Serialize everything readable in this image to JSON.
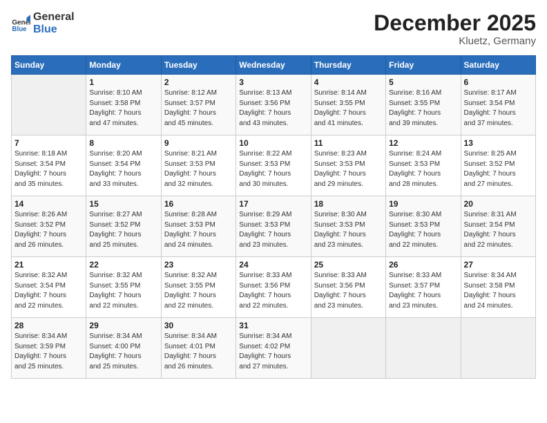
{
  "header": {
    "logo_general": "General",
    "logo_blue": "Blue",
    "month_title": "December 2025",
    "location": "Kluetz, Germany"
  },
  "days_of_week": [
    "Sunday",
    "Monday",
    "Tuesday",
    "Wednesday",
    "Thursday",
    "Friday",
    "Saturday"
  ],
  "weeks": [
    [
      {
        "day": "",
        "info": ""
      },
      {
        "day": "1",
        "info": "Sunrise: 8:10 AM\nSunset: 3:58 PM\nDaylight: 7 hours\nand 47 minutes."
      },
      {
        "day": "2",
        "info": "Sunrise: 8:12 AM\nSunset: 3:57 PM\nDaylight: 7 hours\nand 45 minutes."
      },
      {
        "day": "3",
        "info": "Sunrise: 8:13 AM\nSunset: 3:56 PM\nDaylight: 7 hours\nand 43 minutes."
      },
      {
        "day": "4",
        "info": "Sunrise: 8:14 AM\nSunset: 3:55 PM\nDaylight: 7 hours\nand 41 minutes."
      },
      {
        "day": "5",
        "info": "Sunrise: 8:16 AM\nSunset: 3:55 PM\nDaylight: 7 hours\nand 39 minutes."
      },
      {
        "day": "6",
        "info": "Sunrise: 8:17 AM\nSunset: 3:54 PM\nDaylight: 7 hours\nand 37 minutes."
      }
    ],
    [
      {
        "day": "7",
        "info": "Sunrise: 8:18 AM\nSunset: 3:54 PM\nDaylight: 7 hours\nand 35 minutes."
      },
      {
        "day": "8",
        "info": "Sunrise: 8:20 AM\nSunset: 3:54 PM\nDaylight: 7 hours\nand 33 minutes."
      },
      {
        "day": "9",
        "info": "Sunrise: 8:21 AM\nSunset: 3:53 PM\nDaylight: 7 hours\nand 32 minutes."
      },
      {
        "day": "10",
        "info": "Sunrise: 8:22 AM\nSunset: 3:53 PM\nDaylight: 7 hours\nand 30 minutes."
      },
      {
        "day": "11",
        "info": "Sunrise: 8:23 AM\nSunset: 3:53 PM\nDaylight: 7 hours\nand 29 minutes."
      },
      {
        "day": "12",
        "info": "Sunrise: 8:24 AM\nSunset: 3:53 PM\nDaylight: 7 hours\nand 28 minutes."
      },
      {
        "day": "13",
        "info": "Sunrise: 8:25 AM\nSunset: 3:52 PM\nDaylight: 7 hours\nand 27 minutes."
      }
    ],
    [
      {
        "day": "14",
        "info": "Sunrise: 8:26 AM\nSunset: 3:52 PM\nDaylight: 7 hours\nand 26 minutes."
      },
      {
        "day": "15",
        "info": "Sunrise: 8:27 AM\nSunset: 3:52 PM\nDaylight: 7 hours\nand 25 minutes."
      },
      {
        "day": "16",
        "info": "Sunrise: 8:28 AM\nSunset: 3:53 PM\nDaylight: 7 hours\nand 24 minutes."
      },
      {
        "day": "17",
        "info": "Sunrise: 8:29 AM\nSunset: 3:53 PM\nDaylight: 7 hours\nand 23 minutes."
      },
      {
        "day": "18",
        "info": "Sunrise: 8:30 AM\nSunset: 3:53 PM\nDaylight: 7 hours\nand 23 minutes."
      },
      {
        "day": "19",
        "info": "Sunrise: 8:30 AM\nSunset: 3:53 PM\nDaylight: 7 hours\nand 22 minutes."
      },
      {
        "day": "20",
        "info": "Sunrise: 8:31 AM\nSunset: 3:54 PM\nDaylight: 7 hours\nand 22 minutes."
      }
    ],
    [
      {
        "day": "21",
        "info": "Sunrise: 8:32 AM\nSunset: 3:54 PM\nDaylight: 7 hours\nand 22 minutes."
      },
      {
        "day": "22",
        "info": "Sunrise: 8:32 AM\nSunset: 3:55 PM\nDaylight: 7 hours\nand 22 minutes."
      },
      {
        "day": "23",
        "info": "Sunrise: 8:32 AM\nSunset: 3:55 PM\nDaylight: 7 hours\nand 22 minutes."
      },
      {
        "day": "24",
        "info": "Sunrise: 8:33 AM\nSunset: 3:56 PM\nDaylight: 7 hours\nand 22 minutes."
      },
      {
        "day": "25",
        "info": "Sunrise: 8:33 AM\nSunset: 3:56 PM\nDaylight: 7 hours\nand 23 minutes."
      },
      {
        "day": "26",
        "info": "Sunrise: 8:33 AM\nSunset: 3:57 PM\nDaylight: 7 hours\nand 23 minutes."
      },
      {
        "day": "27",
        "info": "Sunrise: 8:34 AM\nSunset: 3:58 PM\nDaylight: 7 hours\nand 24 minutes."
      }
    ],
    [
      {
        "day": "28",
        "info": "Sunrise: 8:34 AM\nSunset: 3:59 PM\nDaylight: 7 hours\nand 25 minutes."
      },
      {
        "day": "29",
        "info": "Sunrise: 8:34 AM\nSunset: 4:00 PM\nDaylight: 7 hours\nand 25 minutes."
      },
      {
        "day": "30",
        "info": "Sunrise: 8:34 AM\nSunset: 4:01 PM\nDaylight: 7 hours\nand 26 minutes."
      },
      {
        "day": "31",
        "info": "Sunrise: 8:34 AM\nSunset: 4:02 PM\nDaylight: 7 hours\nand 27 minutes."
      },
      {
        "day": "",
        "info": ""
      },
      {
        "day": "",
        "info": ""
      },
      {
        "day": "",
        "info": ""
      }
    ]
  ]
}
